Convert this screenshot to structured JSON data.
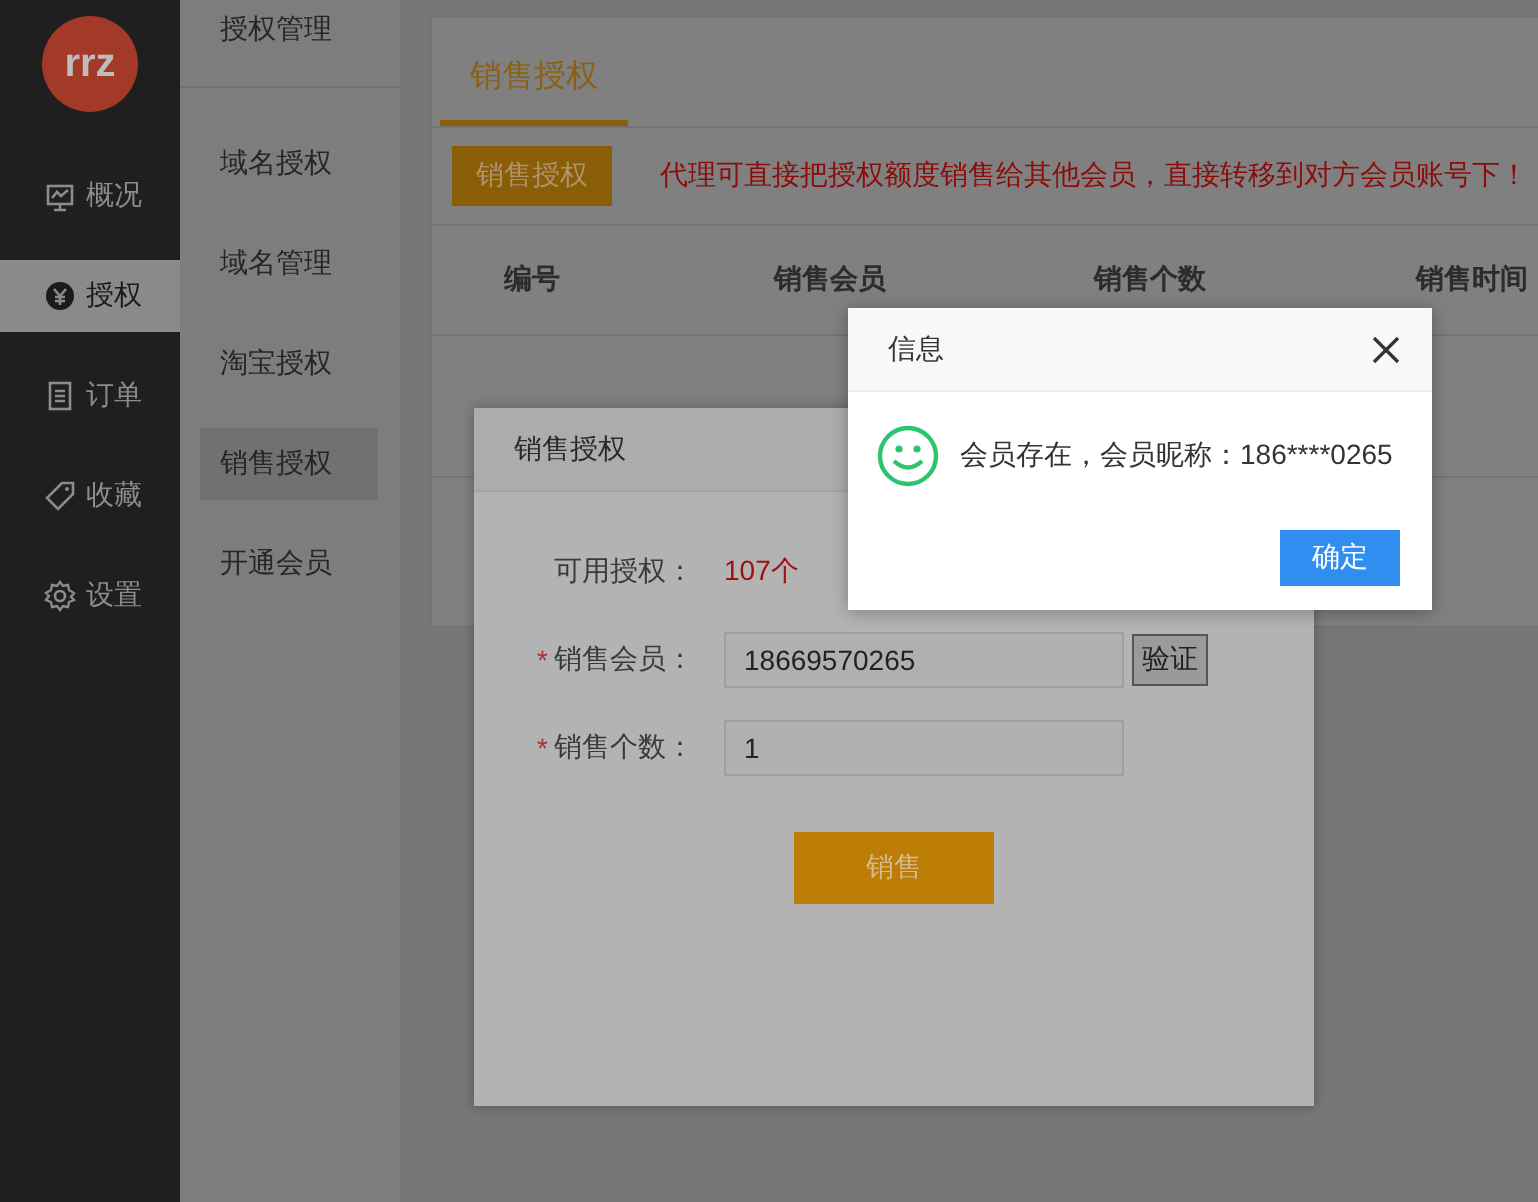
{
  "logo": {
    "text": "rrz"
  },
  "nav": [
    {
      "label": "概况",
      "selected": false
    },
    {
      "label": "授权",
      "selected": true
    },
    {
      "label": "订单",
      "selected": false
    },
    {
      "label": "收藏",
      "selected": false
    },
    {
      "label": "设置",
      "selected": false
    }
  ],
  "subnav": {
    "title": "授权管理",
    "items": [
      {
        "label": "域名授权",
        "selected": false
      },
      {
        "label": "域名管理",
        "selected": false
      },
      {
        "label": "淘宝授权",
        "selected": false
      },
      {
        "label": "销售授权",
        "selected": true
      },
      {
        "label": "开通会员",
        "selected": false
      }
    ]
  },
  "tabs": [
    {
      "label": "销售授权",
      "selected": true
    }
  ],
  "toolbar": {
    "button": "销售授权",
    "notice": "代理可直接把授权额度销售给其他会员，直接转移到对方会员账号下！"
  },
  "table": {
    "columns": [
      "编号",
      "销售会员",
      "销售个数",
      "销售时间"
    ]
  },
  "sale_dialog": {
    "title": "销售授权",
    "fields": [
      {
        "kind": "readout",
        "label": "可用授权：",
        "value": "107个"
      },
      {
        "kind": "input",
        "label": "销售会员：",
        "marker": "*",
        "value": "18669570265",
        "action": "验证"
      },
      {
        "kind": "input",
        "label": "销售个数：",
        "marker": "*",
        "value": "1"
      }
    ],
    "submit": "销售"
  },
  "message": {
    "title": "信息",
    "text": "会员存在，会员昵称：186****0265",
    "button": "确定"
  }
}
